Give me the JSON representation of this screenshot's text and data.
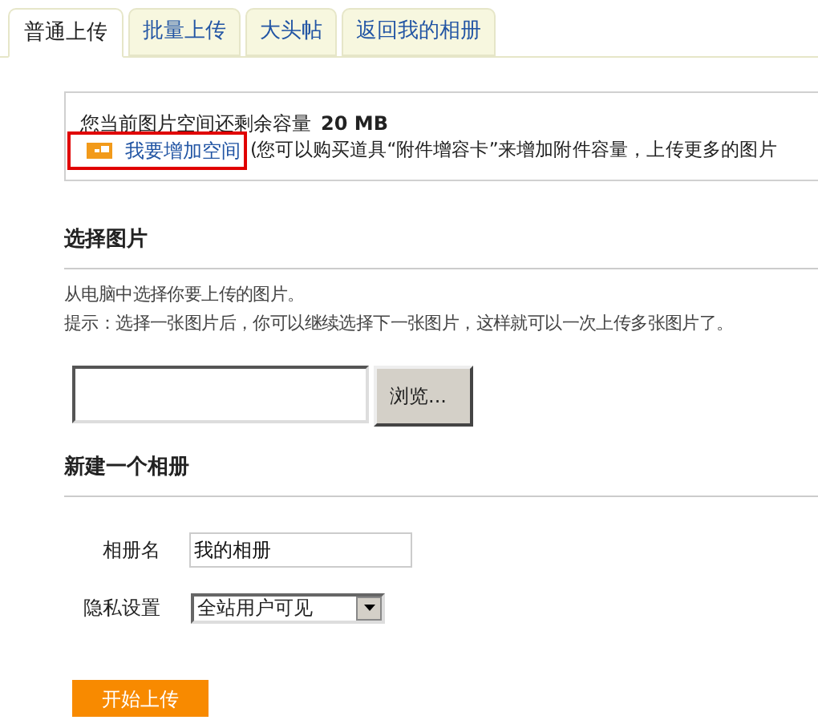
{
  "tabs": [
    {
      "label": "普通上传",
      "selected": true
    },
    {
      "label": "批量上传",
      "selected": false
    },
    {
      "label": "大头帖",
      "selected": false
    },
    {
      "label": "返回我的相册",
      "selected": false
    }
  ],
  "space_notice": {
    "text": "您当前图片空间还剩余容量",
    "amount": "20 MB",
    "link": "我要增加空间",
    "note": "(您可以购买道具“附件增容卡”来增加附件容量，上传更多的图片"
  },
  "select_section": {
    "heading": "选择图片",
    "lines": [
      "从电脑中选择你要上传的图片。",
      "提示：选择一张图片后，你可以继续选择下一张图片，这样就可以一次上传多张图片了。"
    ],
    "browse_button": "浏览..."
  },
  "album_section": {
    "heading": "新建一个相册",
    "fields": [
      {
        "kind": "text",
        "label": "相册名",
        "value": "我的相册"
      },
      {
        "kind": "select",
        "label": "隐私设置",
        "value": "全站用户可见"
      }
    ]
  },
  "submit_button": "开始上传"
}
